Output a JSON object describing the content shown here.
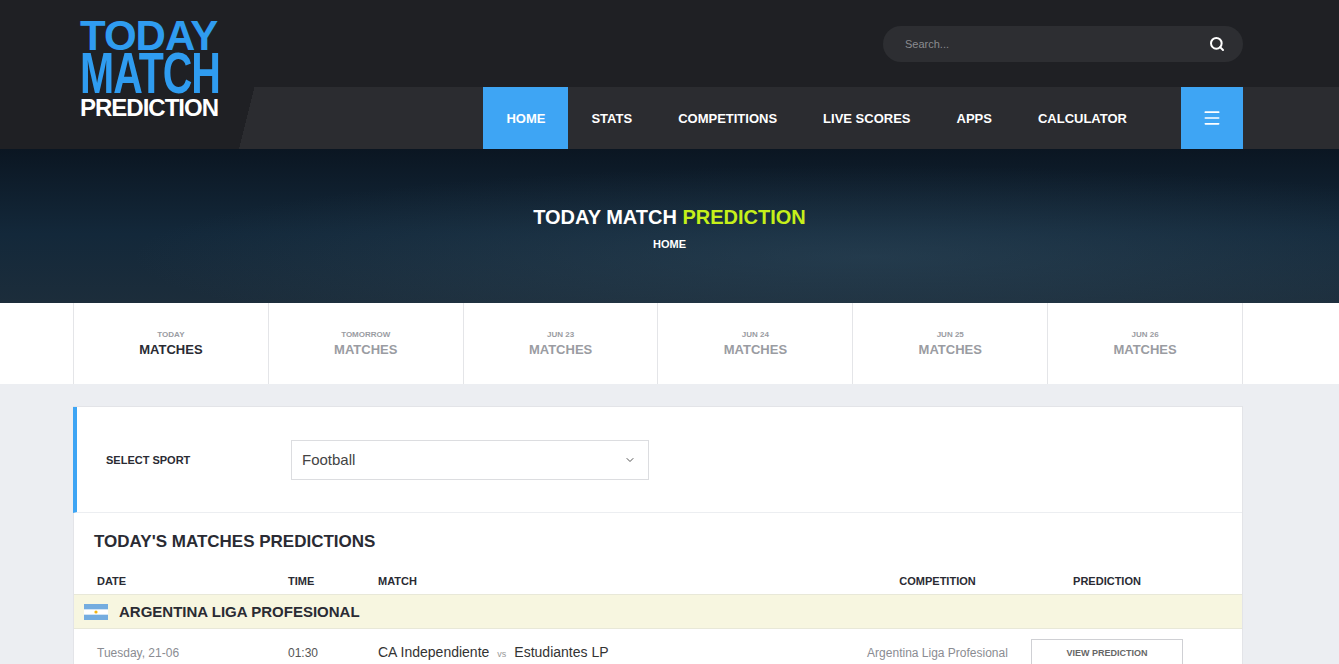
{
  "logo": {
    "lines": [
      "TODAY",
      "MATCH",
      "PREDICTION"
    ]
  },
  "search": {
    "placeholder": "Search..."
  },
  "nav": [
    {
      "label": "HOME",
      "selected": true
    },
    {
      "label": "STATS",
      "selected": false
    },
    {
      "label": "COMPETITIONS",
      "selected": false
    },
    {
      "label": "LIVE SCORES",
      "selected": false
    },
    {
      "label": "APPS",
      "selected": false
    },
    {
      "label": "CALCULATOR",
      "selected": false
    }
  ],
  "hero": {
    "title": "TODAY MATCH",
    "title_accent": "PREDICTION",
    "breadcrumb": "HOME"
  },
  "date_tabs": [
    {
      "top": "TODAY",
      "label": "MATCHES",
      "selected": true
    },
    {
      "top": "TOMORROW",
      "label": "MATCHES",
      "selected": false
    },
    {
      "top": "JUN 23",
      "label": "MATCHES",
      "selected": false
    },
    {
      "top": "JUN 24",
      "label": "MATCHES",
      "selected": false
    },
    {
      "top": "JUN 25",
      "label": "MATCHES",
      "selected": false
    },
    {
      "top": "JUN 26",
      "label": "MATCHES",
      "selected": false
    }
  ],
  "sport_select": {
    "label": "SELECT SPORT",
    "value": "Football"
  },
  "table": {
    "title": "TODAY'S MATCHES PREDICTIONS",
    "columns": [
      "DATE",
      "TIME",
      "MATCH",
      "COMPETITION",
      "PREDICTION"
    ],
    "groups": [
      {
        "league": "ARGENTINA LIGA PROFESIONAL",
        "rows": [
          {
            "date": "Tuesday, 21-06",
            "time": "01:30",
            "home": "CA Independiente",
            "vs": "vs",
            "away": "Estudiantes LP",
            "competition": "Argentina Liga Profesional",
            "button": "VIEW PREDICTION"
          }
        ]
      }
    ]
  }
}
